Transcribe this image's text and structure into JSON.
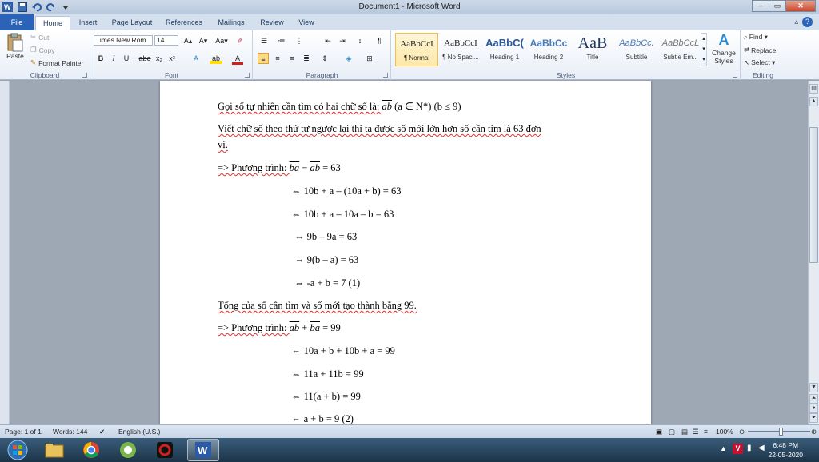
{
  "window": {
    "title": "Document1 - Microsoft Word",
    "controls": {
      "minimize": "–",
      "maximize": "▭",
      "close": "✕"
    }
  },
  "tabs": [
    "File",
    "Home",
    "Insert",
    "Page Layout",
    "References",
    "Mailings",
    "Review",
    "View"
  ],
  "ribbon": {
    "clipboard": {
      "label": "Clipboard",
      "paste": "Paste",
      "cut": "Cut",
      "copy": "Copy",
      "format_painter": "Format Painter"
    },
    "font": {
      "label": "Font",
      "family": "Times New Rom",
      "size": "14",
      "bold": "B",
      "italic": "I",
      "underline": "U",
      "strike": "abe",
      "sub": "x₂",
      "sup": "x²",
      "grow": "A▴",
      "shrink": "A▾",
      "case": "Aa▾",
      "effects": "A",
      "highlight": "ab",
      "color": "A"
    },
    "paragraph": {
      "label": "Paragraph"
    },
    "styles": {
      "label": "Styles",
      "items": [
        {
          "sample": "AaBbCcI",
          "name": "¶ Normal"
        },
        {
          "sample": "AaBbCcI",
          "name": "¶ No Spaci..."
        },
        {
          "sample": "AaBbC(",
          "name": "Heading 1"
        },
        {
          "sample": "AaBbCc",
          "name": "Heading 2"
        },
        {
          "sample": "AaB",
          "name": "Title"
        },
        {
          "sample": "AaBbCc.",
          "name": "Subtitle"
        },
        {
          "sample": "AaBbCcL",
          "name": "Subtle Em..."
        }
      ],
      "change_styles": "Change Styles"
    },
    "editing": {
      "label": "Editing",
      "find": "Find ▾",
      "replace": "Replace",
      "select": "Select ▾"
    }
  },
  "document": {
    "lines": {
      "l1_prefix": "Gọi số tự nhiên cần tìm có hai chữ số là: ",
      "l1_var": "ab",
      "l1_suffix": " (a ∈ N*) (b ≤ 9)",
      "l2": "Viết chữ số theo thứ tự ngược lại thì ta được số mới lớn hơn số cần tìm là 63 đơn",
      "l3": "vị.",
      "l4_prefix": "=> Phương trình: ",
      "l4_a": "ba",
      "l4_op": " − ",
      "l4_b": "ab",
      "l4_suffix": " = 63",
      "l5": "⇔  10b + a – (10a + b) = 63",
      "l6": "⇔  10b + a – 10a – b = 63",
      "l7": "⇔  9b – 9a = 63",
      "l8": "⇔  9(b – a) = 63",
      "l9": "⇔  -a + b = 7 (1)",
      "l10": "Tổng của số cần tìm và số mới tạo thành bằng  99.",
      "l11_prefix": "=> Phương trình: ",
      "l11_a": "ab",
      "l11_op": " + ",
      "l11_b": "ba",
      "l11_suffix": " = 99",
      "l12": "⇔  10a + b + 10b + a = 99",
      "l13": "⇔  11a + 11b = 99",
      "l14": "⇔  11(a + b) = 99",
      "l15": "⇔  a + b = 9 (2)"
    }
  },
  "statusbar": {
    "page": "Page: 1 of 1",
    "words": "Words: 144",
    "language": "English (U.S.)",
    "zoom": "100%",
    "zoom_level": 1.0
  },
  "taskbar": {
    "time": "6:48 PM",
    "date": "22-05-2020"
  },
  "colors": {
    "file_tab": "#2a63b8",
    "ribbon_bg": "#e8eef7",
    "taskbar": "#1c3448"
  }
}
